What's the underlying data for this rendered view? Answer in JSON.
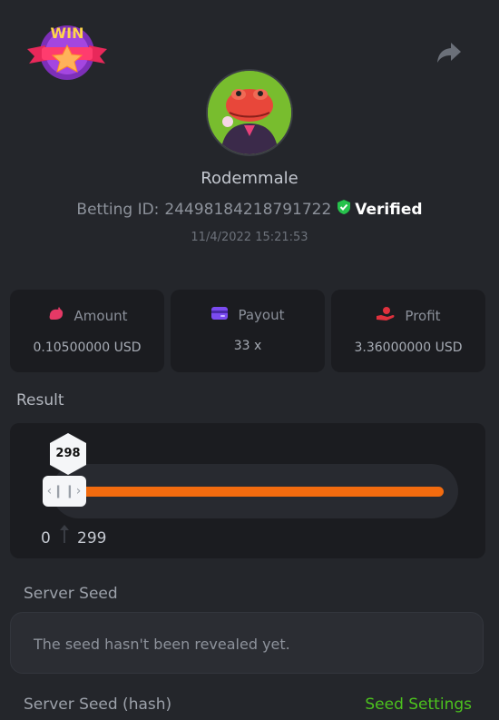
{
  "logo": {
    "text": "WIN"
  },
  "profile": {
    "username": "Rodemmale",
    "betting_id_label": "Betting ID:",
    "betting_id": "24498184218791722",
    "verified_label": "Verified",
    "datetime": "11/4/2022 15:21:53"
  },
  "stats": [
    {
      "label": "Amount",
      "value": "0.10500000 USD",
      "icon": "amount-icon",
      "color": "#e53966"
    },
    {
      "label": "Payout",
      "value": "33 x",
      "icon": "card-icon",
      "color": "#7b4bf0"
    },
    {
      "label": "Profit",
      "value": "3.36000000 USD",
      "icon": "hand-coin-icon",
      "color": "#e0313d"
    }
  ],
  "result": {
    "label": "Result",
    "marker_value": "298",
    "range_min": "0",
    "range_max": "299",
    "fill_fraction": 0.99
  },
  "server_seed": {
    "label": "Server Seed",
    "text": "The seed hasn't been revealed yet."
  },
  "hash": {
    "label": "Server Seed (hash)",
    "settings_link": "Seed Settings"
  },
  "colors": {
    "accent_orange": "#f26b0f",
    "verified_green": "#27c24c",
    "link_green": "#4cc21e"
  }
}
